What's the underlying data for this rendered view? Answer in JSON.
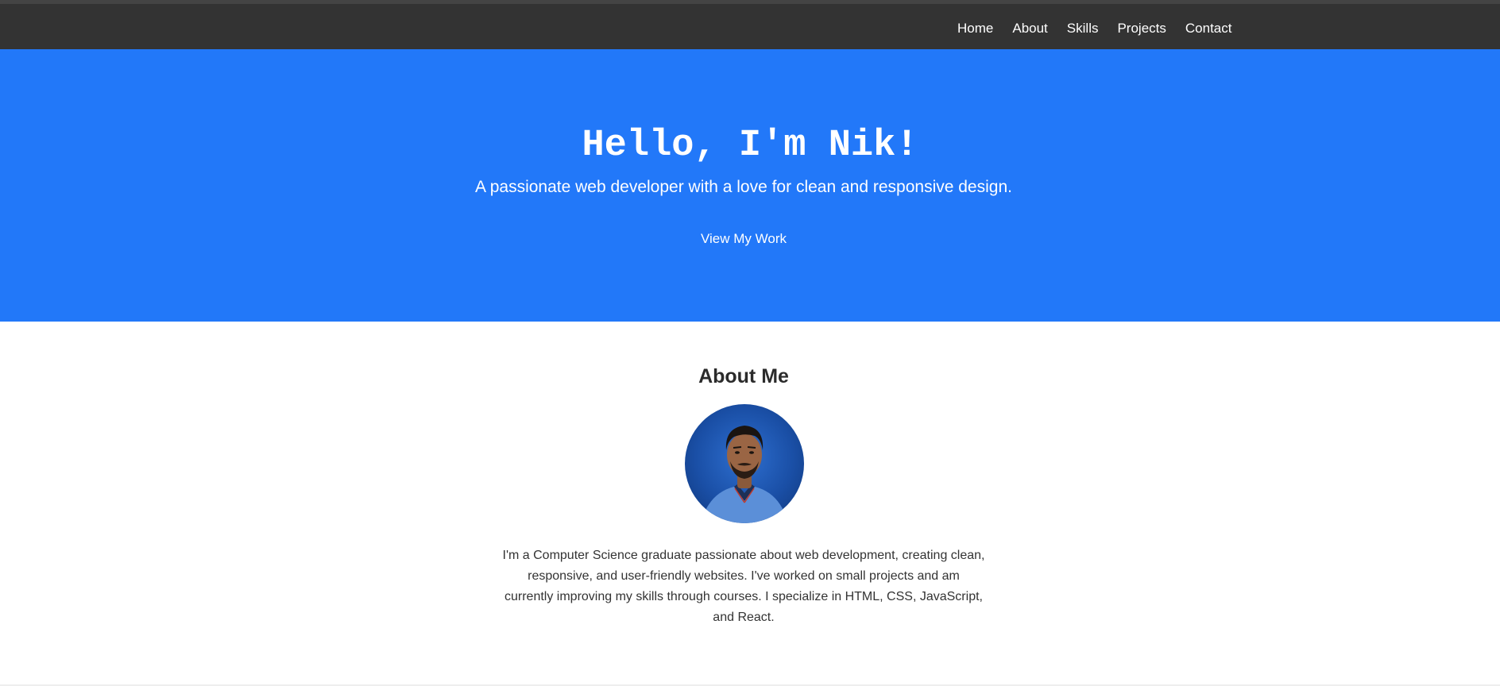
{
  "nav": {
    "items": [
      {
        "label": "Home"
      },
      {
        "label": "About"
      },
      {
        "label": "Skills"
      },
      {
        "label": "Projects"
      },
      {
        "label": "Contact"
      }
    ]
  },
  "hero": {
    "title": "Hello, I'm Nik!",
    "subtitle": "A passionate web developer with a love for clean and responsive design.",
    "cta_label": "View My Work",
    "background_color": "#2278f9"
  },
  "about": {
    "title": "About Me",
    "avatar_icon": "profile-photo",
    "text": "I'm a Computer Science graduate passionate about web development, creating clean, responsive, and user-friendly websites. I've worked on small projects and am currently improving my skills through courses. I specialize in HTML, CSS, JavaScript, and React."
  },
  "colors": {
    "navbar": "#333333",
    "accent": "#2278f9"
  }
}
